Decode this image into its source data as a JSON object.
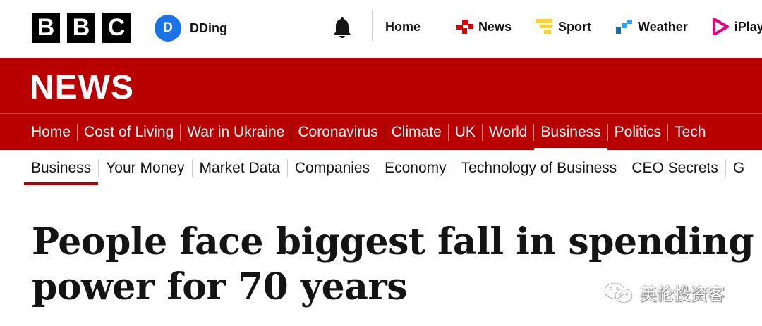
{
  "brand": {
    "letters": [
      "B",
      "B",
      "C"
    ]
  },
  "account": {
    "initial": "D",
    "name": "DDing",
    "avatar_color": "#1a73e8"
  },
  "topnav": {
    "items": [
      {
        "label": "Home",
        "icon": ""
      },
      {
        "label": "News",
        "icon": "news-icon"
      },
      {
        "label": "Sport",
        "icon": "sport-icon"
      },
      {
        "label": "Weather",
        "icon": "weather-icon"
      },
      {
        "label": "iPlayer",
        "icon": "iplayer-icon"
      }
    ]
  },
  "section": {
    "title": "NEWS",
    "band_color": "#b80000"
  },
  "primary_nav": {
    "items": [
      "Home",
      "Cost of Living",
      "War in Ukraine",
      "Coronavirus",
      "Climate",
      "UK",
      "World",
      "Business",
      "Politics",
      "Tech"
    ],
    "active": "Business"
  },
  "secondary_nav": {
    "items": [
      "Business",
      "Your Money",
      "Market Data",
      "Companies",
      "Economy",
      "Technology of Business",
      "CEO Secrets",
      "G"
    ],
    "active": "Business"
  },
  "article": {
    "headline_line1": "People face biggest fall in spending",
    "headline_line2": "power for 70 years"
  },
  "watermark": {
    "text": "英伦投资客"
  }
}
